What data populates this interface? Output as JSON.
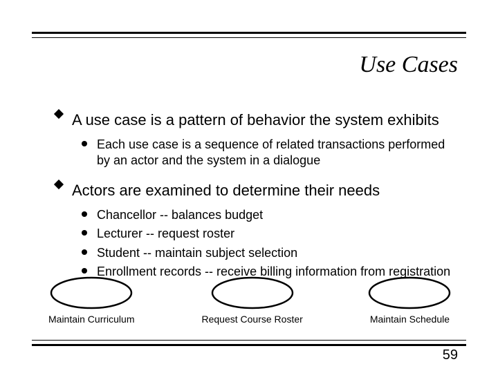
{
  "title": "Use Cases",
  "bullets": {
    "b1": "A use case is a pattern of behavior the system exhibits",
    "b1_sub1": "Each use case is a sequence of related transactions performed by an actor and the system in a dialogue",
    "b2": "Actors are examined to determine their needs",
    "b2_sub1": "Chancellor -- balances budget",
    "b2_sub2": "Lecturer -- request roster",
    "b2_sub3": "Student -- maintain subject selection",
    "b2_sub4": "Enrollment records -- receive billing information from registration"
  },
  "usecases": {
    "u1": "Maintain Curriculum",
    "u2": "Request Course Roster",
    "u3": "Maintain Schedule"
  },
  "page_number": "59"
}
